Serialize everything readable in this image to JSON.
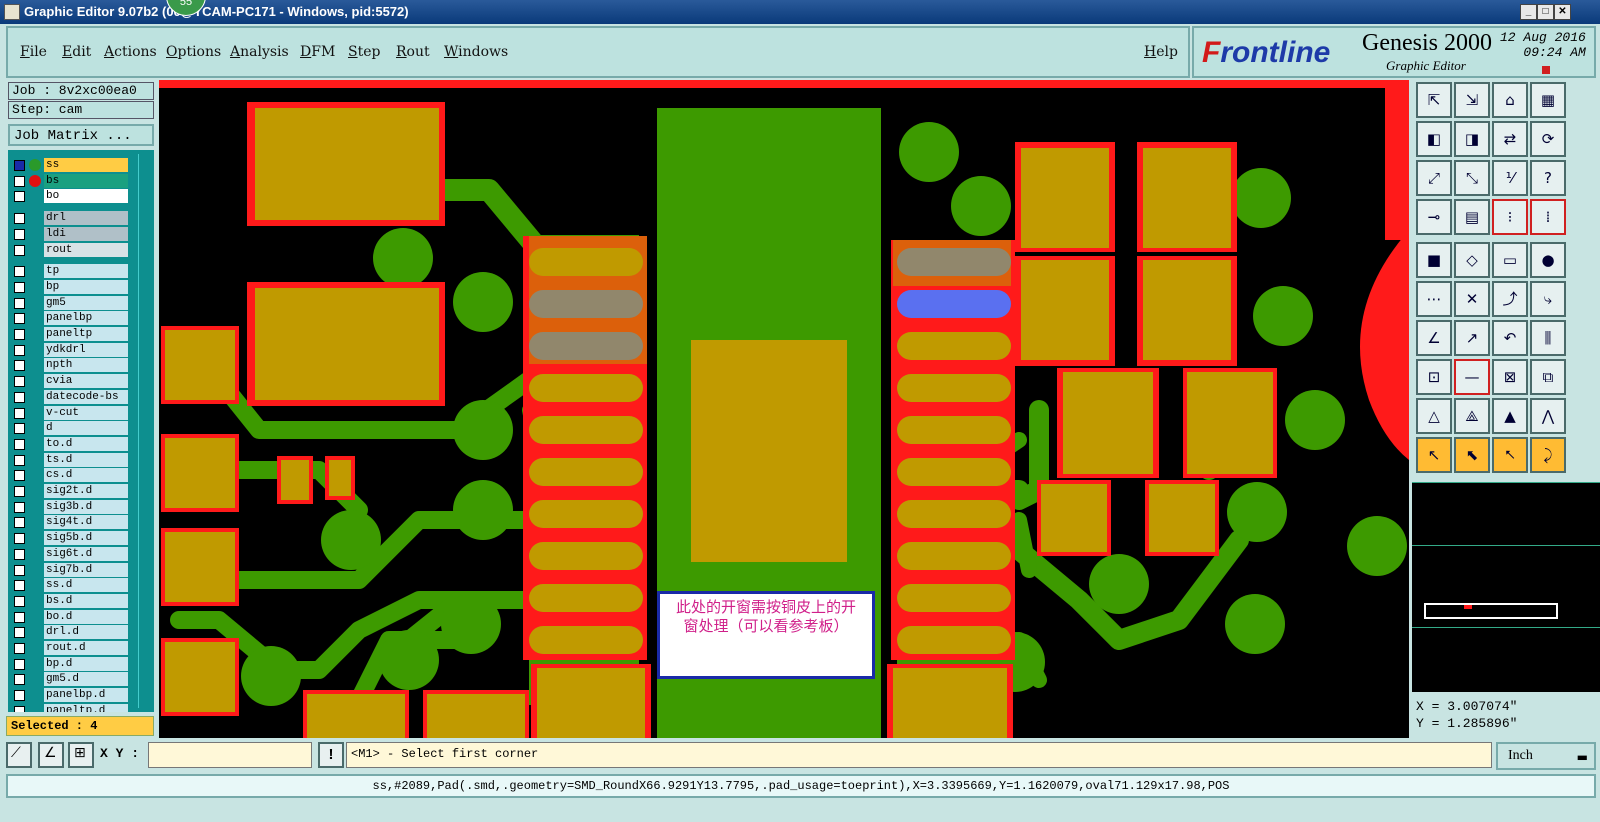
{
  "window": {
    "title": "Graphic Editor 9.07b2 (00@YCAM-PC171 - Windows, pid:5572)",
    "badge": "55",
    "min_label": "_",
    "max_label": "□",
    "close_label": "✕"
  },
  "menu": {
    "items": [
      "File",
      "Edit",
      "Actions",
      "Options",
      "Analysis",
      "DFM",
      "Step",
      "Rout",
      "Windows"
    ],
    "help": "Help"
  },
  "brand": {
    "frontline_f": "F",
    "frontline_rest": "rontline",
    "product": "Genesis 2000",
    "subtitle": "Graphic Editor",
    "date": "12 Aug 2016",
    "time": "09:24 AM"
  },
  "job": {
    "job_label": "Job : 8v2xc00ea0",
    "step_label": "Step: cam",
    "matrix_button": "Job Matrix ..."
  },
  "layers": [
    {
      "name": "ss",
      "style": "active"
    },
    {
      "name": "bs",
      "style": "display"
    },
    {
      "name": "bo",
      "style": "white"
    },
    {
      "name": "drl",
      "style": "grey"
    },
    {
      "name": "ldi",
      "style": "grey"
    },
    {
      "name": "rout",
      "style": "light"
    },
    {
      "name": "tp"
    },
    {
      "name": "bp"
    },
    {
      "name": "gm5"
    },
    {
      "name": "panelbp"
    },
    {
      "name": "paneltp"
    },
    {
      "name": "ydkdrl"
    },
    {
      "name": "npth"
    },
    {
      "name": "cvia"
    },
    {
      "name": "datecode-bs"
    },
    {
      "name": "v-cut"
    },
    {
      "name": "d"
    },
    {
      "name": "to.d"
    },
    {
      "name": "ts.d"
    },
    {
      "name": "cs.d"
    },
    {
      "name": "sig2t.d"
    },
    {
      "name": "sig3b.d"
    },
    {
      "name": "sig4t.d"
    },
    {
      "name": "sig5b.d"
    },
    {
      "name": "sig6t.d"
    },
    {
      "name": "sig7b.d"
    },
    {
      "name": "ss.d"
    },
    {
      "name": "bs.d"
    },
    {
      "name": "bo.d"
    },
    {
      "name": "drl.d"
    },
    {
      "name": "rout.d"
    },
    {
      "name": "bp.d"
    },
    {
      "name": "gm5.d"
    },
    {
      "name": "panelbp.d"
    },
    {
      "name": "paneltp.d"
    }
  ],
  "selected_label": "Selected : 4",
  "annotation": {
    "line1": "此处的开窗需按铜皮上的开",
    "line2": "窗处理（可以看参考板）"
  },
  "coords": {
    "x": "X = 3.007074\"",
    "y": "Y = 1.285896\""
  },
  "command": {
    "xy_label": "X Y :",
    "xy_value": "",
    "warn": "!",
    "prompt": "<M1> - Select first corner",
    "unit": "Inch"
  },
  "status_line": "ss,#2089,Pad(.smd,.geometry=SMD_RoundX66.9291Y13.7795,.pad_usage=toeprint),X=3.3395669,Y=1.1620079,oval71.129x17.98,POS",
  "colors": {
    "copper_green": "#3d9a00",
    "pad_gold": "#c09a00",
    "mask_red": "#ff1a1a",
    "selected_blue": "#5a70f0"
  },
  "toolbar_icons": [
    "fit-page-icon",
    "zoom-area-icon",
    "home-icon",
    "grid-icon",
    "move-left-icon",
    "move-right-icon",
    "mirror-icon",
    "rotate-icon",
    "expand-icon",
    "shrink-icon",
    "scale-icon",
    "help-icon",
    "snap-icon",
    "grid-view-icon",
    "layers-icon",
    "layers-alt-icon",
    "pad-icon",
    "polygon-icon",
    "ruler-icon",
    "circle-icon",
    "connect-icon",
    "cross-icon",
    "add-node-icon",
    "pin-icon",
    "line-icon",
    "arrow-line-icon",
    "undo-arc-icon",
    "align-icon",
    "move-pad-icon",
    "horizontal-line-icon",
    "measure-icon",
    "copy-icon",
    "triangle-icon",
    "triangle-a-icon",
    "triangle-b-icon",
    "triangle-c-icon",
    "select-icon",
    "select-box-icon",
    "select-circle-icon",
    "select-net-icon"
  ]
}
